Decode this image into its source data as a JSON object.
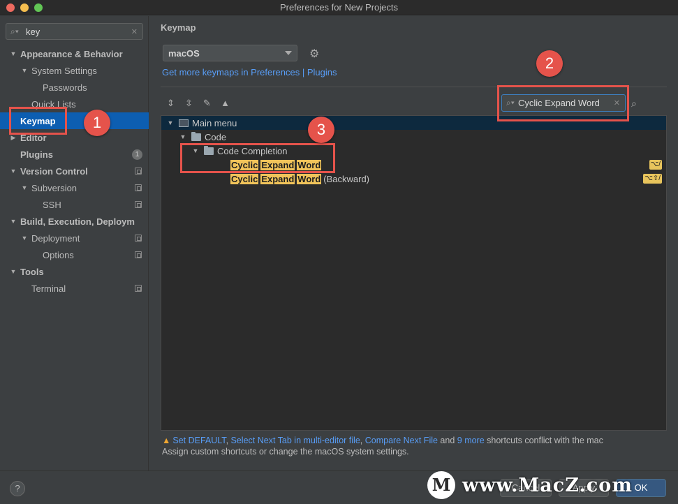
{
  "window": {
    "title": "Preferences for New Projects"
  },
  "sidebar": {
    "search_value": "key",
    "items": [
      {
        "label": "Appearance & Behavior",
        "level": 0,
        "expanded": true,
        "bold": true
      },
      {
        "label": "System Settings",
        "level": 1,
        "expanded": true,
        "bold": false
      },
      {
        "label": "Passwords",
        "level": 2,
        "bold": false
      },
      {
        "label": "Quick Lists",
        "level": 1,
        "bold": false
      },
      {
        "label": "Keymap",
        "level": 0,
        "bold": true,
        "selected": true
      },
      {
        "label": "Editor",
        "level": 0,
        "expanded": false,
        "bold": true
      },
      {
        "label": "Plugins",
        "level": 0,
        "bold": true,
        "badge": "1"
      },
      {
        "label": "Version Control",
        "level": 0,
        "expanded": true,
        "bold": true,
        "project_scope": true
      },
      {
        "label": "Subversion",
        "level": 1,
        "expanded": true,
        "bold": false,
        "project_scope": true
      },
      {
        "label": "SSH",
        "level": 2,
        "bold": false,
        "project_scope": true
      },
      {
        "label": "Build, Execution, Deploym",
        "level": 0,
        "expanded": true,
        "bold": true
      },
      {
        "label": "Deployment",
        "level": 1,
        "expanded": true,
        "bold": false,
        "project_scope": true
      },
      {
        "label": "Options",
        "level": 2,
        "bold": false,
        "project_scope": true
      },
      {
        "label": "Tools",
        "level": 0,
        "expanded": true,
        "bold": true
      },
      {
        "label": "Terminal",
        "level": 1,
        "bold": false,
        "project_scope": true
      }
    ]
  },
  "main": {
    "heading": "Keymap",
    "keymap_select": "macOS",
    "links_text": "Get more keymaps in Preferences | Plugins",
    "filter_value": "Cyclic Expand Word",
    "tree": {
      "root": "Main menu",
      "group": "Code",
      "subgroup": "Code Completion",
      "action1": {
        "words": [
          "Cyclic",
          "Expand",
          "Word"
        ],
        "suffix": "",
        "shortcut": "⌥/"
      },
      "action2": {
        "words": [
          "Cyclic",
          "Expand",
          "Word"
        ],
        "suffix": "(Backward)",
        "shortcut": "⌥⇧/"
      }
    },
    "warning": {
      "conflicts": [
        "Set DEFAULT",
        "Select Next Tab in multi-editor file",
        "Compare Next File"
      ],
      "more": "9 more",
      "suffix": " shortcuts conflict with the mac",
      "line2": "Assign custom shortcuts or change the macOS system settings."
    }
  },
  "footer": {
    "help": "?",
    "cancel": "Cancel",
    "apply": "Apply",
    "ok": "OK"
  },
  "watermark": {
    "logo": "M",
    "text": "www.MacZ.com"
  },
  "annotations": [
    "1",
    "2",
    "3"
  ],
  "colors": {
    "accent": "#0d5eb1",
    "link": "#589df6",
    "highlight": "#f0c35a",
    "annotation": "#e5534b"
  }
}
